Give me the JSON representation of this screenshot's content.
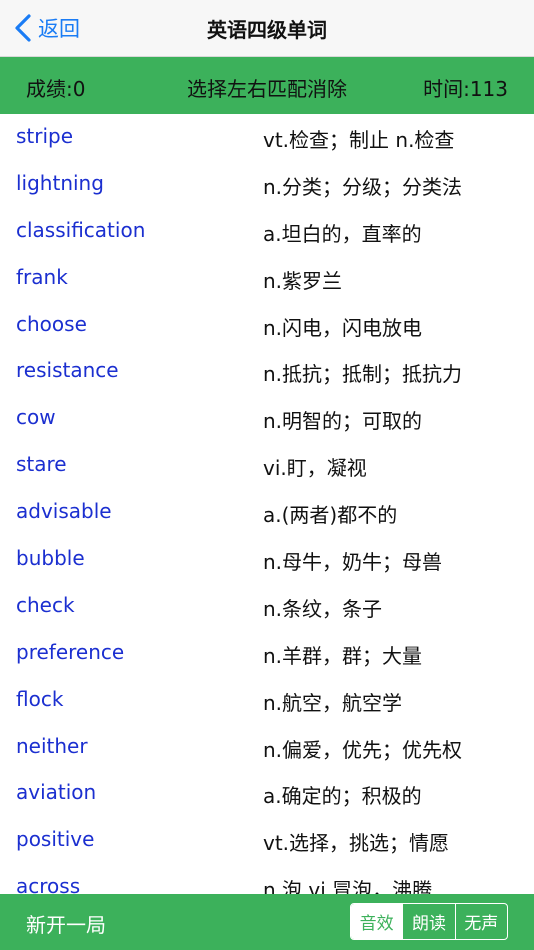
{
  "nav": {
    "back_label": "返回",
    "title": "英语四级单词"
  },
  "scorebar": {
    "score": "成绩:0",
    "instruction": "选择左右匹配消除",
    "timer": "时间:113"
  },
  "words": [
    {
      "en": "stripe",
      "cn": "vt.检查；制止 n.检查"
    },
    {
      "en": "lightning",
      "cn": "n.分类；分级；分类法"
    },
    {
      "en": "classification",
      "cn": "a.坦白的，直率的"
    },
    {
      "en": "frank",
      "cn": "n.紫罗兰"
    },
    {
      "en": "choose",
      "cn": "n.闪电，闪电放电"
    },
    {
      "en": "resistance",
      "cn": "n.抵抗；抵制；抵抗力"
    },
    {
      "en": "cow",
      "cn": "n.明智的；可取的"
    },
    {
      "en": "stare",
      "cn": "vi.盯，凝视"
    },
    {
      "en": "advisable",
      "cn": "a.(两者)都不的"
    },
    {
      "en": "bubble",
      "cn": "n.母牛，奶牛；母兽"
    },
    {
      "en": "check",
      "cn": "n.条纹，条子"
    },
    {
      "en": "preference",
      "cn": "n.羊群，群；大量"
    },
    {
      "en": "flock",
      "cn": "n.航空，航空学"
    },
    {
      "en": "neither",
      "cn": "n.偏爱，优先；优先权"
    },
    {
      "en": "aviation",
      "cn": "a.确定的；积极的"
    },
    {
      "en": "positive",
      "cn": "vt.选择，挑选；情愿"
    },
    {
      "en": "across",
      "cn": "n.泡 vi.冒泡，沸腾"
    }
  ],
  "bottom": {
    "new_game": "新开一局",
    "modes": [
      "音效",
      "朗读",
      "无声"
    ],
    "active_mode": "音效"
  },
  "colors": {
    "accent_green": "#3cb15b",
    "word_blue": "#1b2fd0",
    "ios_blue": "#1a7cf5"
  }
}
